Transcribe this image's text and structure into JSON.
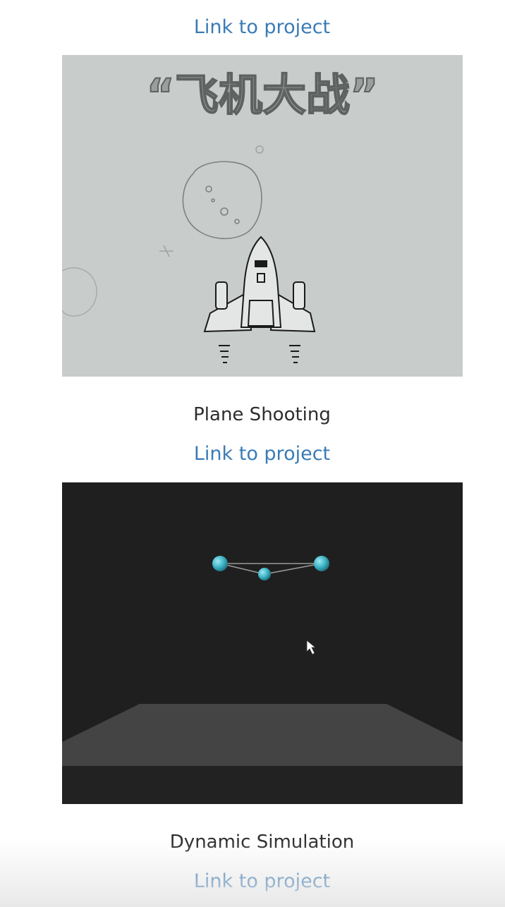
{
  "projects": [
    {
      "link_label": "Link to project",
      "title": ""
    },
    {
      "link_label": "Link to project",
      "title": "Plane Shooting",
      "thumbnail": {
        "banner_text": "“飞机大战”",
        "icon": "fighter-jet-icon",
        "background_color": "#c8cccb"
      }
    },
    {
      "link_label": "Link to project",
      "title": "Dynamic Simulation",
      "thumbnail": {
        "icon": "particle-spring-icon",
        "background_color": "#1f1f1f",
        "particle_color": "#3fb6c8"
      }
    }
  ],
  "colors": {
    "link": "#3a7bb5",
    "title": "#2d2d2d",
    "background": "#ffffff"
  }
}
